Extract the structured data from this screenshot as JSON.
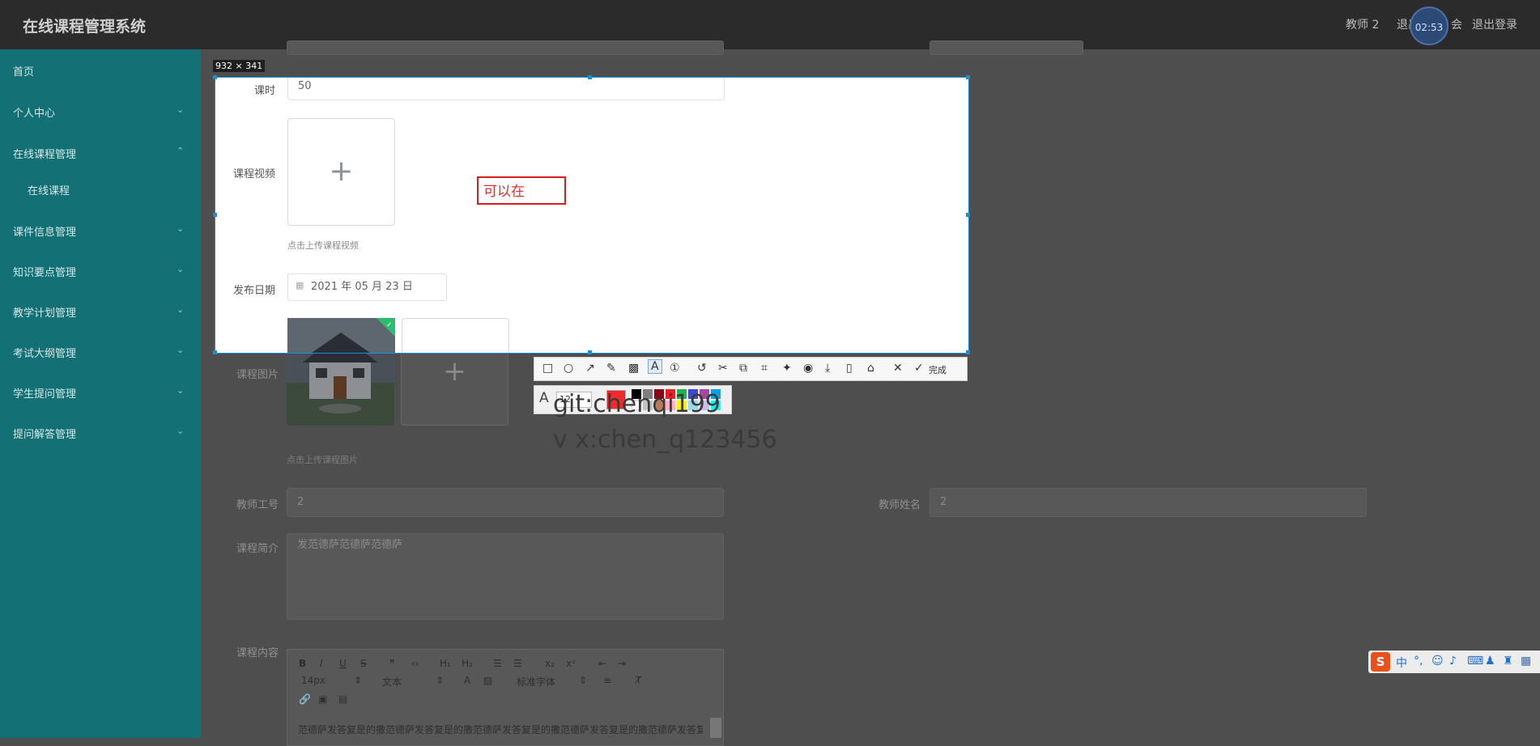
{
  "app": {
    "title": "在线课程管理系统"
  },
  "header": {
    "user": "教师 2",
    "link_partial": "退出",
    "link_partial2": "会",
    "logout": "退出登录",
    "timer": "02:53"
  },
  "sidebar": {
    "items": [
      {
        "label": "首页"
      },
      {
        "label": "个人中心"
      },
      {
        "label": "在线课程管理"
      },
      {
        "label": "课件信息管理"
      },
      {
        "label": "知识要点管理"
      },
      {
        "label": "教学计划管理"
      },
      {
        "label": "考试大纲管理"
      },
      {
        "label": "学生提问管理"
      },
      {
        "label": "提问解答管理"
      }
    ],
    "sub_items": [
      {
        "label": "在线课程"
      }
    ]
  },
  "form": {
    "hours_label": "课时",
    "hours_value": "50",
    "video_label": "课程视频",
    "video_hint": "点击上传课程视频",
    "date_label": "发布日期",
    "date_value": "2021 年 05 月 23 日",
    "image_label": "课程图片",
    "image_hint": "点击上传课程图片",
    "teacher_no_label": "教师工号",
    "teacher_no_value": "2",
    "teacher_name_label": "教师姓名",
    "teacher_name_value": "2",
    "intro_label": "课程简介",
    "intro_value": "发范德萨范德萨范德萨",
    "content_label": "课程内容",
    "content_text": "范德萨发答复是的撒范德萨发答复是的撒范德萨发答复是的撒范德萨发答复是的撒范德萨发答复"
  },
  "editor_toolbar": {
    "font_size": "14px",
    "text_type": "文本",
    "font_family": "标准字体"
  },
  "capture": {
    "size": "932 × 341",
    "text_annotation": "可以在",
    "done_label": "完成",
    "font_size_value": "12"
  },
  "watermark": {
    "line1": "git:chenqi199",
    "line2": "v x:chen_q123456"
  },
  "colors": {
    "topbar": "#2b2b2b",
    "sidebar": "#137075",
    "selection": "#1a8fd8",
    "annotation": "#d62020",
    "palette": [
      "#000000",
      "#7f7f7f",
      "#880015",
      "#ed1c24",
      "#22b14c",
      "#3f48cc",
      "#a349a4",
      "#00a2e8",
      "#ffffff",
      "#c3c3c3",
      "#b97a57",
      "#ffaec9",
      "#fff200",
      "#99d9ea",
      "#c8bfe7",
      "#00ffff"
    ]
  }
}
